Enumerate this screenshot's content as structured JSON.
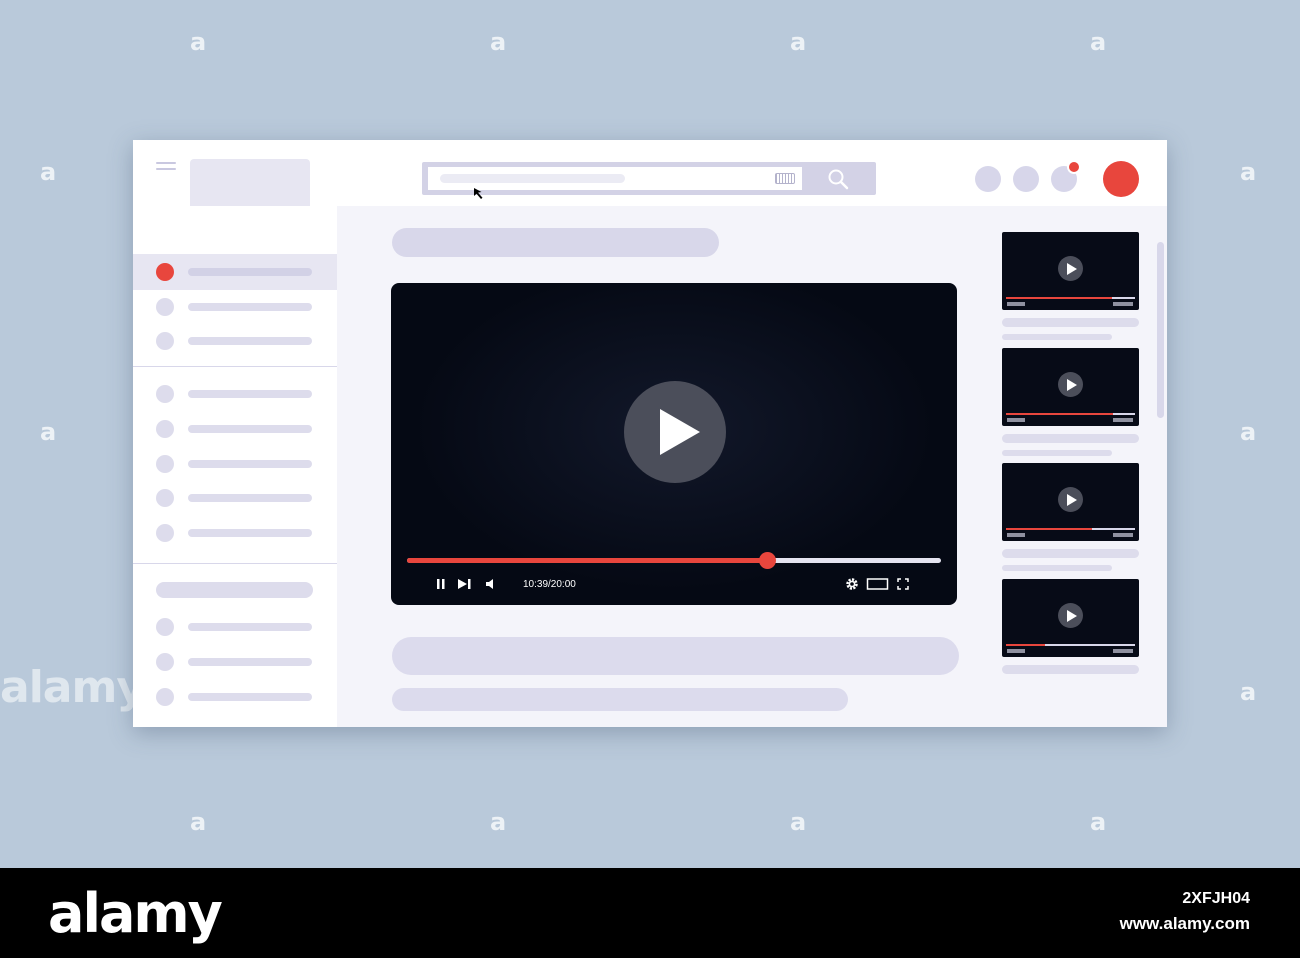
{
  "player": {
    "time": "10:39/20:00",
    "progress_fraction": 0.674,
    "icons": [
      "pause-icon",
      "next-icon",
      "volume-icon",
      "settings-icon",
      "theater-icon",
      "fullscreen-icon",
      "play-icon"
    ]
  },
  "header": {
    "icons": [
      "menu-icon",
      "keyboard-icon",
      "search-icon"
    ],
    "notification_dot": true
  },
  "recommendations": [
    {
      "progress_fraction": 0.82
    },
    {
      "progress_fraction": 0.83
    },
    {
      "progress_fraction": 0.67
    },
    {
      "progress_fraction": 0.3
    }
  ],
  "colors": {
    "accent": "#e8463d",
    "background": "#b9c9da",
    "player_bg": "#050914",
    "placeholder": "#dddcec"
  },
  "watermark": {
    "brand": "alamy",
    "image_id": "2XFJH04",
    "site": "www.alamy.com",
    "tile": "a"
  }
}
